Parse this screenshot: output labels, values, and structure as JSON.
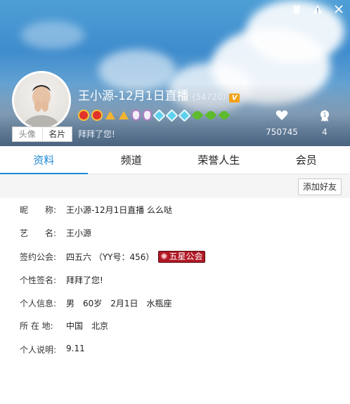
{
  "window_controls": [
    "shirt-icon",
    "warning-icon",
    "close-icon"
  ],
  "profile": {
    "name": "王小源-12月1日直播",
    "uid": "(54720)",
    "vip_badge": "V",
    "signature": "拜拜了您!",
    "avatar_tabs": [
      "头像",
      "名片"
    ]
  },
  "stats": {
    "fans": "750745",
    "rank": "4"
  },
  "badges": [
    "crown",
    "crown",
    "gold",
    "gold",
    "pink",
    "pink",
    "blue",
    "blue",
    "blue",
    "green",
    "green",
    "green"
  ],
  "tabs": [
    "资料",
    "频道",
    "荣誉人生",
    "会员"
  ],
  "toolbar": {
    "add_friend": "添加好友"
  },
  "info": [
    {
      "label": "昵　　称:",
      "value": "王小源-12月1日直播 么么哒"
    },
    {
      "label": "艺　　名:",
      "value": "王小源"
    },
    {
      "label": "签约公会:",
      "value": "四五六 （YY号：456）",
      "badge": "五星公会"
    },
    {
      "label": "个性签名:",
      "value": "拜拜了您!"
    },
    {
      "label": "个人信息:",
      "value": "男　60岁　2月1日　水瓶座"
    },
    {
      "label": "所 在 地:",
      "value": "中国　北京"
    },
    {
      "label": "个人说明:",
      "value": "9.11"
    }
  ],
  "colors": {
    "accent": "#1e89d6",
    "guild_badge": "#b01824",
    "vip_badge": "#f2a31c"
  }
}
